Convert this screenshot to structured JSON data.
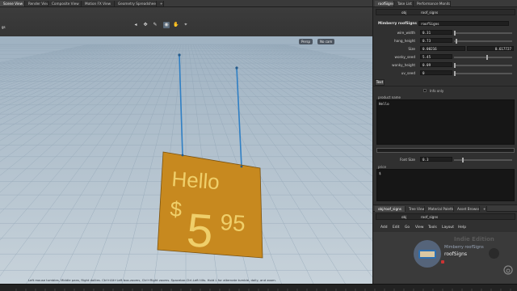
{
  "top_tabs": [
    "Scene View",
    "Render View",
    "Composite View",
    "Motion FX View",
    "Geometry Spreadsheet",
    "+"
  ],
  "pane_tabs": [
    "roofSigns",
    "Take List",
    "Performance Monitor"
  ],
  "viewport": {
    "left_label": "gs",
    "persp_label": "Persp",
    "cam_label": "No cam",
    "help_text": "Left mouse tumbles, Middle pans, Right dollies. Ctrl+Alt+Left box-zooms, Ctrl+Right zooms. Spacebar-Ctrl-Left tilts. Hold L for alternate tumble, dolly, and zoom.",
    "sign": {
      "line1": "Hello",
      "dollar": "$",
      "dollars": "5",
      "cents": "95",
      "color": "#c7891f"
    }
  },
  "param_pane": {
    "path": [
      "obj",
      "roof_signs"
    ],
    "node_type": "Mimberry roofSigns",
    "node_name": "roofSigns",
    "params": [
      {
        "label": "wire_width",
        "value": "0.31"
      },
      {
        "label": "hang_height",
        "value": "0.73"
      },
      {
        "label": "Size",
        "value": "0.00216",
        "value2": "0.617727"
      },
      {
        "label": "wonky_seed",
        "value": "5.45"
      },
      {
        "label": "wonky_height",
        "value": "0.09"
      },
      {
        "label": "uv_seed",
        "value": "0"
      }
    ],
    "text_tab": "Text",
    "info_only": "Info only",
    "product_name_label": "product name",
    "product_name_value": "Hello",
    "font_size_label": "Font Size",
    "font_size_value": "0.3",
    "price_label": "price",
    "price_value": "$"
  },
  "network": {
    "tabs": [
      "obj/roof_signs",
      "Tree View",
      "Material Palette",
      "Asset Browser",
      "+"
    ],
    "path": [
      "obj",
      "roof_signs"
    ],
    "menu": [
      "Add",
      "Edit",
      "Go",
      "View",
      "Tools",
      "Layout",
      "Help"
    ],
    "watermark": "Indie Edition",
    "node_type_text": "Mimberry roofSigns",
    "node_name_text": "roofSigns"
  }
}
